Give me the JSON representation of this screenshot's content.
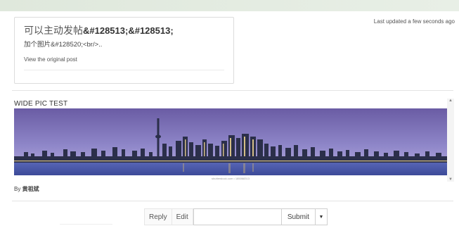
{
  "post": {
    "title_text": "可以主动发帖",
    "title_entities": "&#128513;&#128513;",
    "subtitle": "加个图片&#128520;<br/>..",
    "link_text": "View the original post"
  },
  "status": {
    "updated": "Last updated a few seconds ago"
  },
  "picture": {
    "title": "WIDE PIC TEST",
    "watermark": "shutterstock.com • 185068313"
  },
  "byline": {
    "prefix": "By",
    "author": "黄祖斌"
  },
  "reply_bar": {
    "reply_label": "Reply",
    "edit_label": "Edit",
    "input_value": "",
    "submit_label": "Submit",
    "caret_icon": "caret-down-icon"
  },
  "colors": {
    "sky_top": "#6b5ca3",
    "sky_bottom": "#8e86c8",
    "water": "#4a58a8"
  }
}
